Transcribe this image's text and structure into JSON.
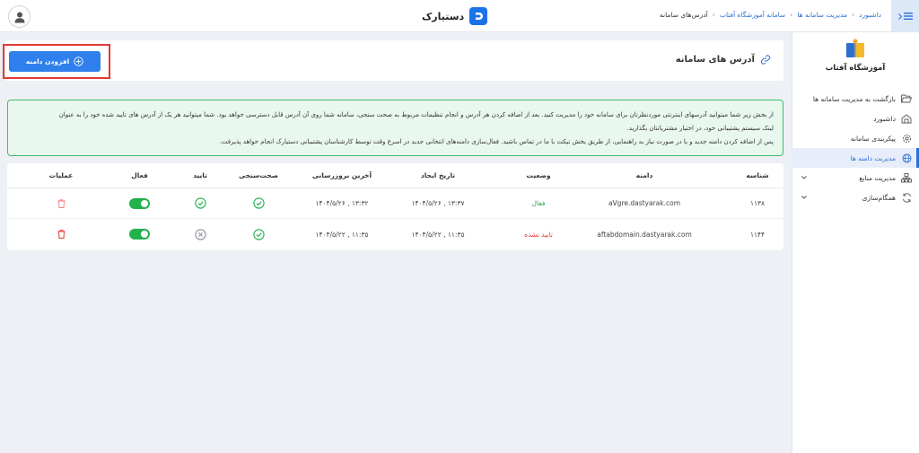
{
  "topbar": {
    "brand": "دستیارک",
    "breadcrumb": {
      "items": [
        "داشبورد",
        "مدیریت سامانه ها",
        "سامانه آموزشگاه آفتاب"
      ],
      "current": "آدرس‌های سامانه"
    }
  },
  "sidebar": {
    "org_name": "آموزشگاه آفتاب",
    "items": [
      {
        "label": "بازگشت به مدیریت سامانه ها",
        "icon": "folder-open-icon"
      },
      {
        "label": "داشبورد",
        "icon": "dashboard-icon"
      },
      {
        "label": "پیکربندی سامانه",
        "icon": "gear-icon"
      },
      {
        "label": "مدیریت دامنه ها",
        "icon": "globe-icon",
        "active": true
      },
      {
        "label": "مدیریت منابع",
        "icon": "server-icon",
        "expandable": true
      },
      {
        "label": "همگام‌سازی",
        "icon": "sync-icon",
        "expandable": true
      }
    ]
  },
  "main": {
    "title": "آدرس های سامانه",
    "add_button": "افزودن دامنه",
    "info": {
      "line1": "از بخش زیر شما میتوانید آدرسهای اینترنتی موردنظرتان برای سامانه خود را مدیریت کنید. بعد از اضافه کردن هر آدرس و انجام تنظیمات مربوط به صحت سنجی، سامانه شما روی آن آدرس قابل دسترسی خواهد بود. شما میتوانید هر یک از آدرس های تایید شده خود را به عنوان",
      "line2": "لینک سیستم پشتیبانی خود، در اختیار مشتریانتان بگذارید.",
      "line3": "پس از اضافه کردن دامنه جدید و یا در صورت نیاز به راهنمایی، از طریق بخش تیکت با ما در تماس باشید. فعال‌سازی دامنه‌های انتخابی جدید در اسرع وقت توسط کارشناسان پشتیبانی دستیارک انجام خواهد پذیرفت."
    },
    "table": {
      "headers": {
        "id": "شناسه",
        "domain": "دامنه",
        "status": "وضعیت",
        "created": "تاریخ ایجاد",
        "updated": "آخرین بروزرسانی",
        "health": "صحت‌سنجی",
        "verify": "تایید",
        "active": "فعال",
        "ops": "عملیات"
      },
      "rows": [
        {
          "id": "۱۱۳۸",
          "domain": "aVgre.dastyarak.com",
          "status": "فعال",
          "status_kind": "ok",
          "created": "۱۴۰۴/۵/۲۶ , ۱۳:۳۷",
          "updated": "۱۴۰۴/۵/۲۶ , ۱۳:۳۲",
          "health": true,
          "verified": true,
          "active": true
        },
        {
          "id": "۱۱۴۴",
          "domain": "aftabdomain.dastyarak.com",
          "status": "تایید نشده",
          "status_kind": "bad",
          "created": "۱۴۰۴/۵/۲۲ , ۱۱:۳۵",
          "updated": "۱۴۰۴/۵/۲۲ , ۱۱:۳۵",
          "health": true,
          "verified": false,
          "active": true
        }
      ]
    }
  },
  "colors": {
    "primary": "#2f80ed",
    "success": "#22b14c",
    "danger": "#e53935",
    "highlight": "#e53935"
  }
}
